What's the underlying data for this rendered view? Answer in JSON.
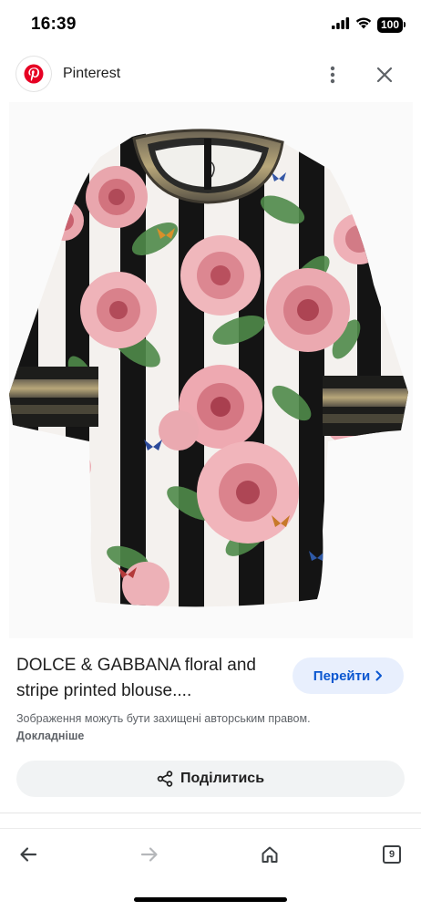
{
  "status_bar": {
    "time": "16:39",
    "battery": "100",
    "icons": [
      "signal-icon",
      "wifi-icon",
      "battery-icon"
    ]
  },
  "source": {
    "name": "Pinterest",
    "logo_icon": "pinterest-logo-icon",
    "brand_color": "#e60023"
  },
  "image": {
    "subject": "floral-striped-blouse-image"
  },
  "result": {
    "title": "DOLCE & GABBANA floral and stripe printed blouse....",
    "visit_label": "Перейти",
    "copyright_text": "Зображення можуть бути захищені авторським правом.",
    "copyright_more": "Докладніше",
    "share_label": "Поділитись"
  },
  "nav": {
    "tabs_count": "9",
    "icons": [
      "back-arrow-icon",
      "forward-arrow-icon",
      "home-icon",
      "tabs-icon"
    ]
  },
  "colors": {
    "accent": "#0b57d0",
    "visit_bg": "#e8effd",
    "share_bg": "#f1f3f4"
  }
}
